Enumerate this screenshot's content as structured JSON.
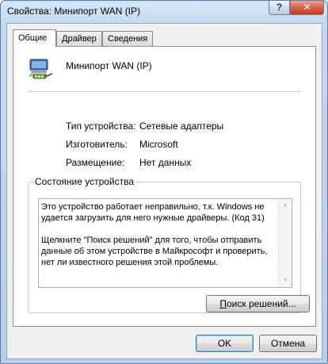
{
  "window": {
    "title": "Свойства: Минипорт WAN (IP)",
    "help_label": "?",
    "close_label": "✕"
  },
  "tabs": [
    {
      "label": "Общие",
      "active": true
    },
    {
      "label": "Драйвер",
      "active": false
    },
    {
      "label": "Сведения",
      "active": false
    }
  ],
  "device": {
    "name": "Минипорт WAN (IP)",
    "icon": "network-adapter-icon"
  },
  "properties": {
    "type_label": "Тип устройства:",
    "type_value": "Сетевые адаптеры",
    "manufacturer_label": "Изготовитель:",
    "manufacturer_value": "Microsoft",
    "location_label": "Размещение:",
    "location_value": "Нет данных"
  },
  "status": {
    "group_label": "Состояние устройства",
    "text": "Это устройство работает неправильно, т.к. Windows не удается загрузить для него нужные драйверы. (Код 31)\n\nЩелкните \"Поиск решений\" для того, чтобы отправить данные об этом устройстве в Майкрософт и проверить, нет ли известного решения этой проблемы.",
    "find_solutions_label": "Поиск решений..."
  },
  "buttons": {
    "ok_label": "OK",
    "cancel_label": "Отмена"
  }
}
